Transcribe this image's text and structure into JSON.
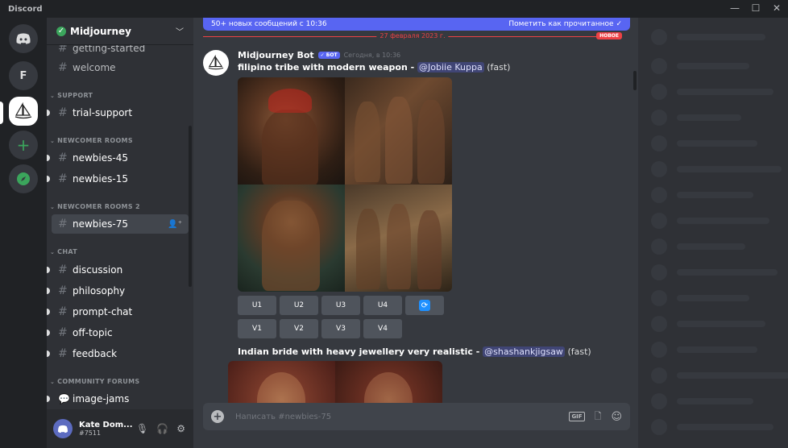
{
  "window": {
    "app_name": "Discord",
    "controls": [
      "—",
      "☐",
      "✕"
    ]
  },
  "guilds": [
    {
      "name": "Home",
      "icon": "discord-icon"
    },
    {
      "name": "F",
      "icon": ""
    },
    {
      "name": "Midjourney",
      "icon": "sailboat-icon"
    },
    {
      "name": "Add a Server",
      "icon": "plus-icon"
    },
    {
      "name": "Explore",
      "icon": "compass-icon"
    }
  ],
  "server": {
    "name": "Midjourney",
    "verified": true
  },
  "channels": {
    "top": [
      {
        "name": "getting-started"
      },
      {
        "name": "welcome"
      }
    ],
    "categories": [
      {
        "label": "SUPPORT",
        "items": [
          {
            "name": "trial-support"
          }
        ]
      },
      {
        "label": "NEWCOMER ROOMS",
        "items": [
          {
            "name": "newbies-45"
          },
          {
            "name": "newbies-15"
          }
        ]
      },
      {
        "label": "NEWCOMER ROOMS 2",
        "items": [
          {
            "name": "newbies-75",
            "active": true
          }
        ]
      },
      {
        "label": "CHAT",
        "items": [
          {
            "name": "discussion"
          },
          {
            "name": "philosophy"
          },
          {
            "name": "prompt-chat"
          },
          {
            "name": "off-topic"
          },
          {
            "name": "feedback"
          }
        ]
      },
      {
        "label": "COMMUNITY FORUMS",
        "items": [
          {
            "name": "image-jams"
          }
        ]
      }
    ]
  },
  "user": {
    "name": "Kate Dom...",
    "tag": "#7511"
  },
  "chat": {
    "new_messages_banner": "50+ новых сообщений с 10:36",
    "mark_read": "Пометить как прочитанное",
    "date_separator": "27 февраля 2023 г.",
    "new_badge": "НОВОЕ",
    "message": {
      "author": "Midjourney Bot",
      "bot_badge": "✓ БОТ",
      "time": "Сегодня, в 10:36",
      "prompt": "filipino tribe with modern weapon",
      "separator": " - ",
      "mention": "@Jobiie Kuppa",
      "mode": "(fast)",
      "upscale_buttons": [
        "U1",
        "U2",
        "U3",
        "U4"
      ],
      "variation_buttons": [
        "V1",
        "V2",
        "V3",
        "V4"
      ]
    },
    "message2": {
      "prompt": "Indian bride with heavy jewellery very realistic",
      "separator": " - ",
      "mention": "@shashankjigsaw",
      "mode": "(fast)"
    },
    "input_placeholder": "Написать #newbies-75",
    "input_icons": [
      "gift-icon",
      "sticker-icon",
      "emoji-icon"
    ],
    "gif_label": "GIF"
  },
  "colors": {
    "accent": "#5865f2",
    "danger": "#ed4245",
    "online": "#3ba55c"
  }
}
